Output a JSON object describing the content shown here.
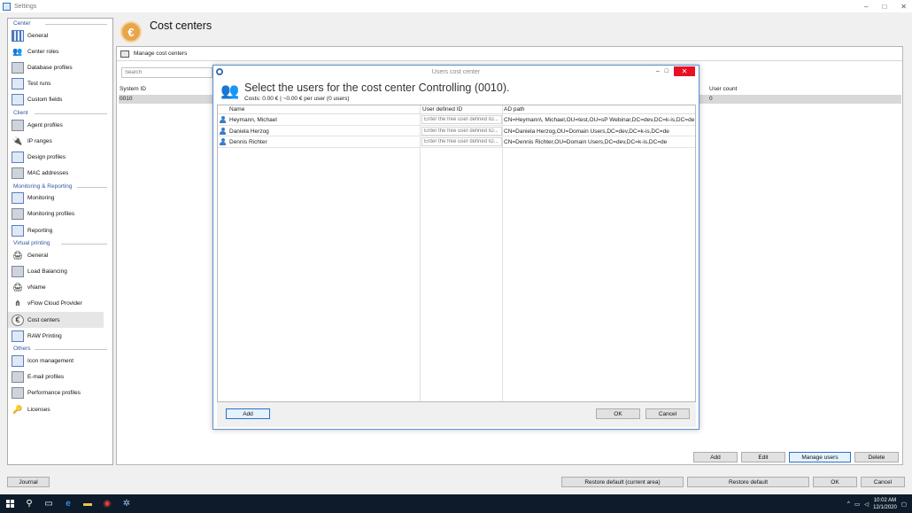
{
  "window": {
    "title": "Settings",
    "minimize": "–",
    "maximize": "□",
    "close": "✕"
  },
  "nav": {
    "groups": [
      {
        "title": "Center",
        "items": [
          "General",
          "Center roles",
          "Database profiles",
          "Test runs",
          "Custom fields"
        ]
      },
      {
        "title": "Client",
        "items": [
          "Agent profiles",
          "IP ranges",
          "Design profiles",
          "MAC addresses"
        ]
      },
      {
        "title": "Monitoring & Reporting",
        "items": [
          "Monitoring",
          "Monitoring profiles",
          "Reporting"
        ]
      },
      {
        "title": "Virtual printing",
        "items": [
          "General",
          "Load Balancing",
          "vName",
          "vFlow Cloud Provider",
          "Cost centers",
          "RAW Printing"
        ]
      },
      {
        "title": "Others",
        "items": [
          "Icon management",
          "E-mail profiles",
          "Performance profiles",
          "Licenses"
        ]
      }
    ]
  },
  "page": {
    "title": "Cost centers",
    "icon": "euro-icon",
    "section_title": "Manage cost centers",
    "search_placeholder": "Search",
    "columns": {
      "system_id": "System ID",
      "user_count": "User count"
    },
    "rows": [
      {
        "system_id": "0010",
        "user_count": "0"
      }
    ],
    "buttons": {
      "add": "Add",
      "edit": "Edit",
      "manage_users": "Manage users",
      "delete": "Delete"
    }
  },
  "footer": {
    "journal": "Journal",
    "restore_current": "Restore default (current area)",
    "restore": "Restore default",
    "ok": "OK",
    "cancel": "Cancel"
  },
  "dialog": {
    "window_title": "Users cost center",
    "heading": "Select the users for the cost center Controlling (0010).",
    "subheading": "Costs: 0.00 € | ~0.00 € per user (0 users)",
    "columns": {
      "name": "Name",
      "user_defined_id": "User defined ID",
      "ad_path": "AD path"
    },
    "udid_placeholder": "Enter the free user defined ID...",
    "users": [
      {
        "name": "Heymann, Michael",
        "ad_path": "CN=Heymann\\, Michael,OU=test,OU=sP Webinar,DC=dev,DC=k-is,DC=de"
      },
      {
        "name": "Daniela Herzog",
        "ad_path": "CN=Daniela Herzog,OU=Domain Users,DC=dev,DC=k-is,DC=de"
      },
      {
        "name": "Dennis Richter",
        "ad_path": "CN=Dennis Richter,OU=Domain Users,DC=dev,DC=k-is,DC=de"
      }
    ],
    "buttons": {
      "add": "Add",
      "ok": "OK",
      "cancel": "Cancel"
    }
  },
  "taskbar": {
    "time": "10:02 AM",
    "date": "12/1/2020"
  },
  "colors": {
    "accent": "#2a72c8",
    "close_red": "#e81123",
    "euro": "#e8a54a",
    "taskbar": "#0d1b2a"
  }
}
